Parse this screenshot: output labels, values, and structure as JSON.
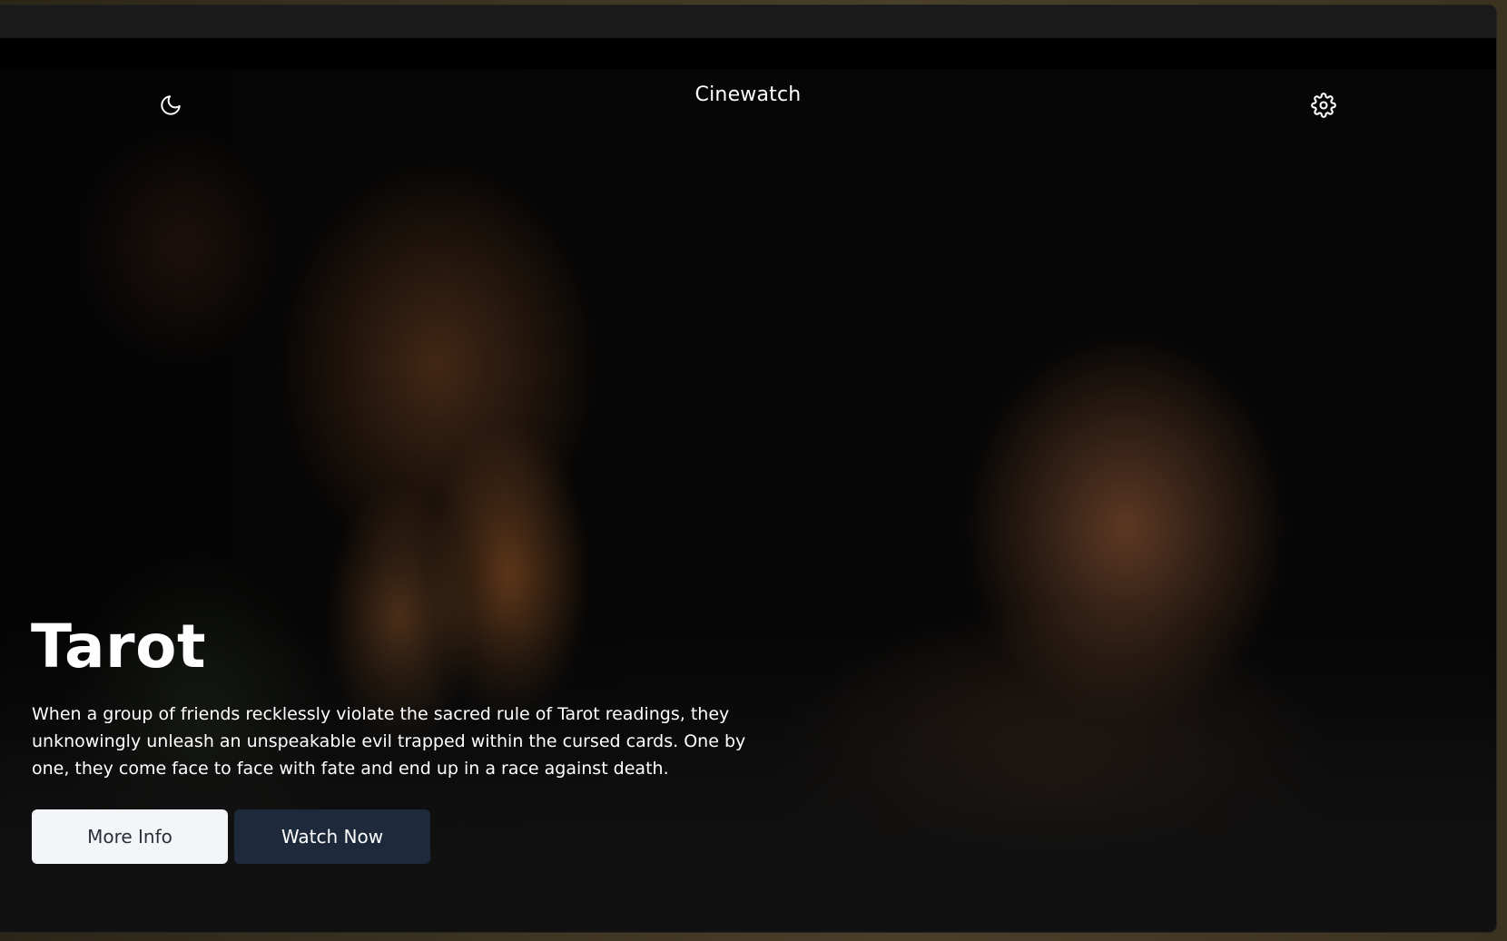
{
  "header": {
    "app_title": "Cinewatch",
    "theme_toggle_icon": "moon-icon",
    "settings_icon": "gear-icon"
  },
  "featured": {
    "title": "Tarot",
    "description": "When a group of friends recklessly violate the sacred rule of Tarot readings, they unknowingly unleash an unspeakable evil trapped within the cursed cards. One by one, they come face to face with fate and end up in a race against death.",
    "more_info_label": "More Info",
    "watch_now_label": "Watch Now"
  },
  "colors": {
    "background": "#111111",
    "primary_button": "#f3f5f8",
    "secondary_button": "#1e293b",
    "text": "#ffffff"
  }
}
